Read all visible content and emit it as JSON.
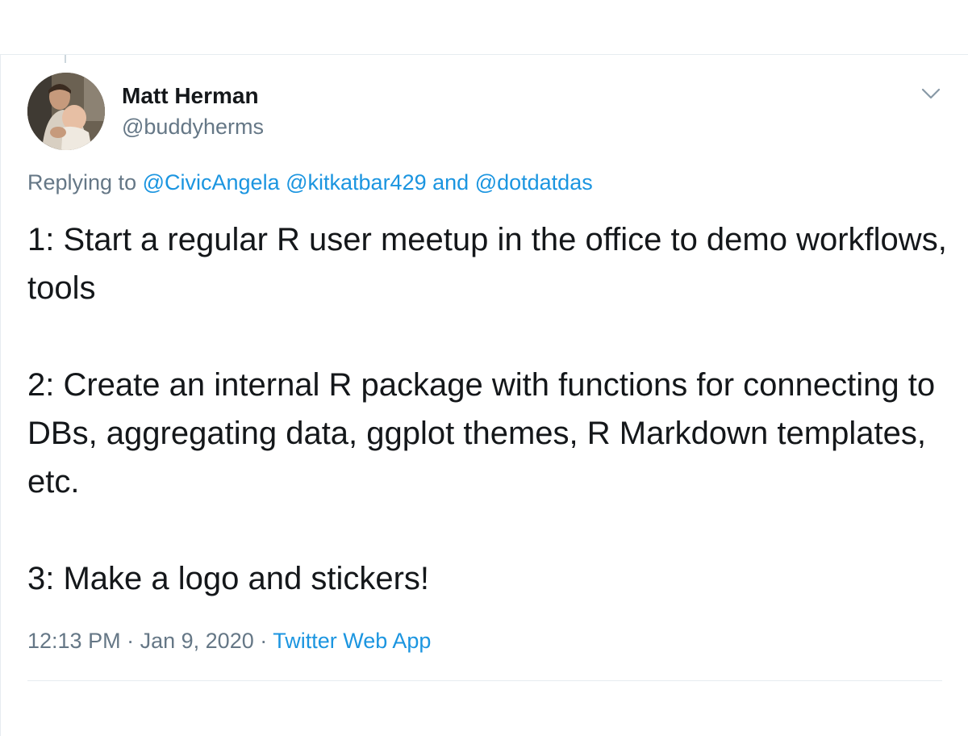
{
  "author": {
    "name": "Matt Herman",
    "handle": "@buddyherms"
  },
  "reply": {
    "prefix": "Replying to",
    "mentions": [
      "@CivicAngela",
      "@kitkatbar429"
    ],
    "conjunction": "and",
    "last_mention": "@dotdatdas"
  },
  "tweet": {
    "lines": [
      "1: Start a regular R user meetup in the office to demo workflows, tools",
      "2: Create an internal R package with functions for connecting to DBs, aggregating data, ggplot themes, R Markdown templates, etc.",
      "3: Make a logo and stickers!"
    ]
  },
  "meta": {
    "time": "12:13 PM",
    "separator": "·",
    "date": "Jan 9, 2020",
    "source": "Twitter Web App"
  },
  "colors": {
    "link": "#1b95e0",
    "secondary_text": "#657786",
    "primary_text": "#14171a",
    "border": "#e6ecf0"
  },
  "icons": {
    "more": "chevron-down-icon"
  }
}
